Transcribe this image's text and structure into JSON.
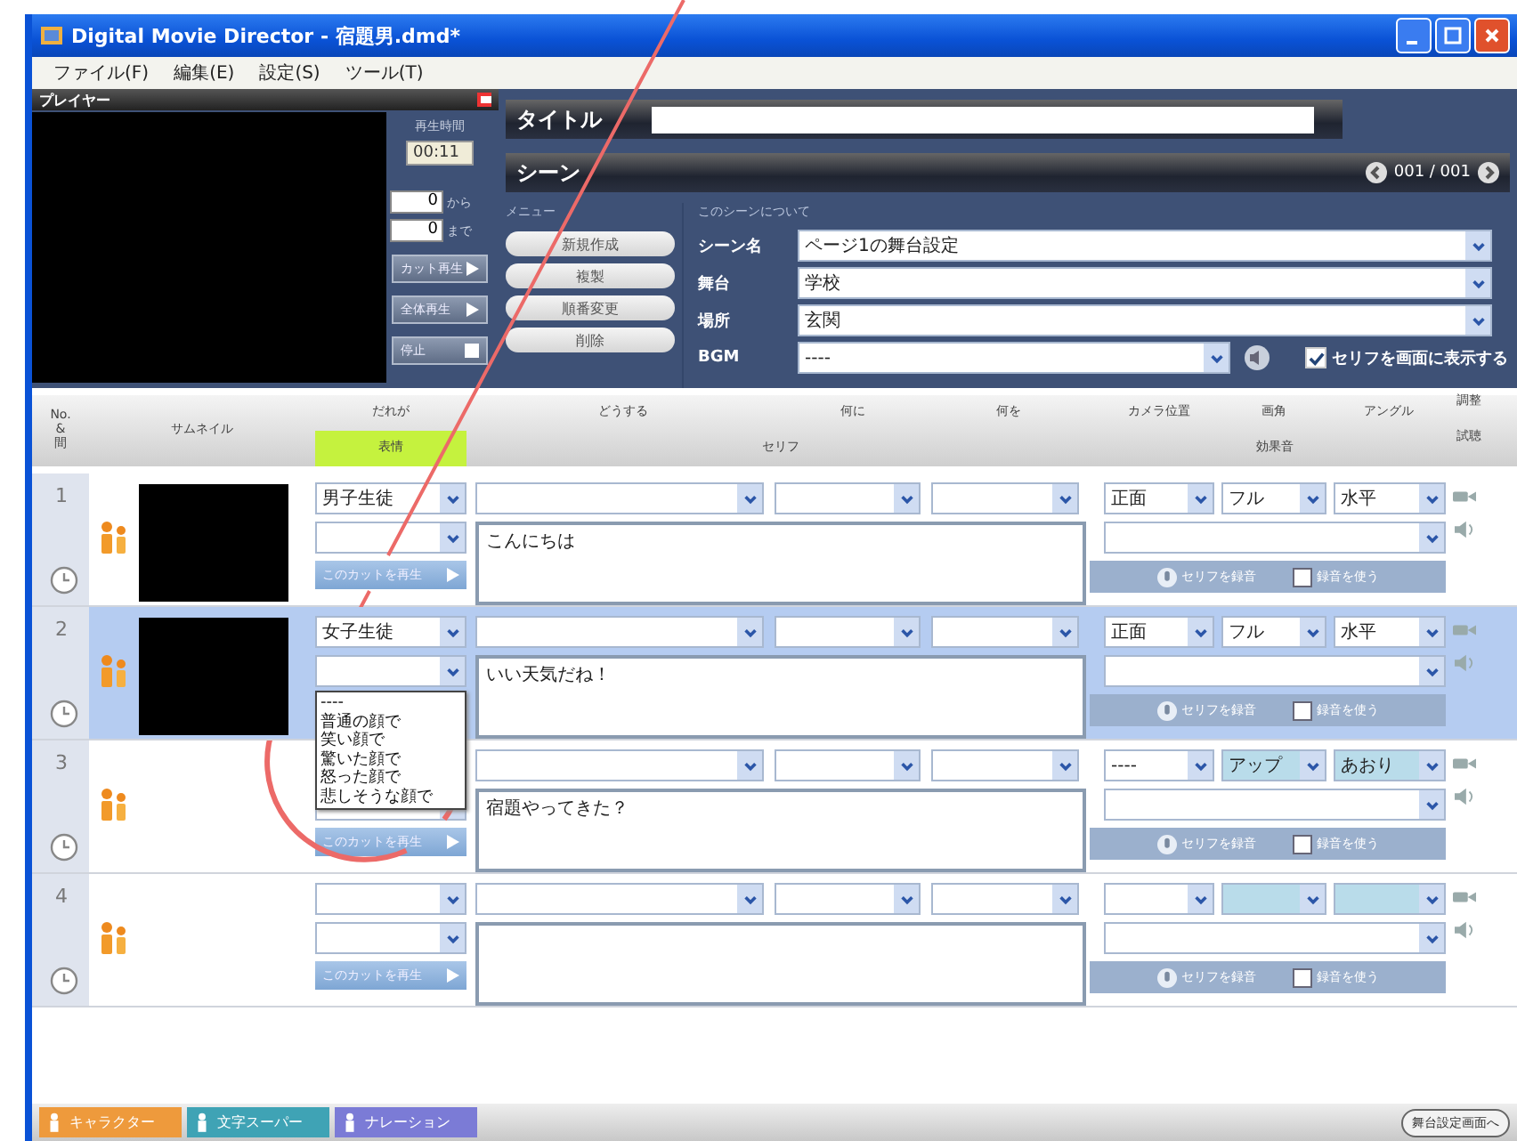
{
  "window": {
    "title": "Digital Movie Director - 宿題男.dmd*"
  },
  "menu": [
    "ファイル(F)",
    "編集(E)",
    "設定(S)",
    "ツール(T)"
  ],
  "player": {
    "title": "プレイヤー",
    "time_label": "再生時間",
    "time": "00:11",
    "from": {
      "value": "0",
      "label": "から"
    },
    "to": {
      "value": "0",
      "label": "まで"
    },
    "buttons": [
      {
        "label": "カット再生",
        "kind": "play"
      },
      {
        "label": "全体再生",
        "kind": "play"
      },
      {
        "label": "停止",
        "kind": "stop"
      }
    ]
  },
  "title_bar": {
    "label": "タイトル"
  },
  "scene": {
    "label": "シーン",
    "page": "001 / 001",
    "menu_label": "メニュー",
    "menu": [
      "新規作成",
      "複製",
      "順番変更",
      "削除"
    ],
    "about_label": "このシーンについて",
    "fields": [
      {
        "label": "シーン名",
        "value": "ページ1の舞台設定"
      },
      {
        "label": "舞台",
        "value": "学校"
      },
      {
        "label": "場所",
        "value": "玄関"
      },
      {
        "label": "BGM",
        "value": "----"
      }
    ],
    "show_dialogue": {
      "label": "セリフを画面に表示する",
      "checked": true
    }
  },
  "columns": {
    "number": "No.\n&\n間",
    "thumbnail": "サムネイル",
    "who": "だれが",
    "expression": "表情",
    "action": "どうする",
    "to_whom": "何に",
    "object": "何を",
    "dialogue": "セリフ",
    "camera_position": "カメラ位置",
    "framing": "画角",
    "angle": "アングル",
    "sound": "効果音",
    "adjust": "調整",
    "preview": "試聴"
  },
  "rows": [
    {
      "number": "1",
      "selected": false,
      "thumbnail": true,
      "who": "男子生徒",
      "dialogue": "こんにちは",
      "camera": [
        {
          "value": "正面",
          "highlighted": false
        },
        {
          "value": "フル",
          "highlighted": false
        },
        {
          "value": "水平",
          "highlighted": false
        }
      ],
      "play_label": "このカットを再生",
      "record_label": "セリフを録音",
      "use_recording": {
        "label": "録音を使う",
        "checked": false
      }
    },
    {
      "number": "2",
      "selected": true,
      "thumbnail": true,
      "who": "女子生徒",
      "dialogue": "いい天気だね！",
      "camera": [
        {
          "value": "正面",
          "highlighted": false
        },
        {
          "value": "フル",
          "highlighted": false
        },
        {
          "value": "水平",
          "highlighted": false
        }
      ],
      "expression_menu": {
        "open": true,
        "options": [
          "----",
          "普通の顔で",
          "笑い顔で",
          "驚いた顔で",
          "怒った顔で",
          "悲しそうな顔で"
        ]
      },
      "record_label": "セリフを録音",
      "use_recording": {
        "label": "録音を使う",
        "checked": false
      }
    },
    {
      "number": "3",
      "selected": false,
      "thumbnail": false,
      "dialogue": "宿題やってきた？",
      "camera": [
        {
          "value": "----",
          "highlighted": false
        },
        {
          "value": "アップ",
          "highlighted": true
        },
        {
          "value": "あおり",
          "highlighted": true
        }
      ],
      "play_label": "このカットを再生",
      "record_label": "セリフを録音",
      "use_recording": {
        "label": "録音を使う",
        "checked": false
      }
    },
    {
      "number": "4",
      "selected": false,
      "thumbnail": false,
      "camera": [
        {
          "highlighted": false
        },
        {
          "highlighted": true
        },
        {
          "highlighted": true
        }
      ],
      "play_label": "このカットを再生",
      "record_label": "セリフを録音",
      "use_recording": {
        "label": "録音を使う",
        "checked": false
      }
    }
  ],
  "tabs": [
    {
      "label": "キャラクター",
      "color": "#ee9a3c"
    },
    {
      "label": "文字スーパー",
      "color": "#3fa3b5"
    },
    {
      "label": "ナレーション",
      "color": "#7b7bd6"
    }
  ],
  "next_button": "舞台設定画面へ"
}
